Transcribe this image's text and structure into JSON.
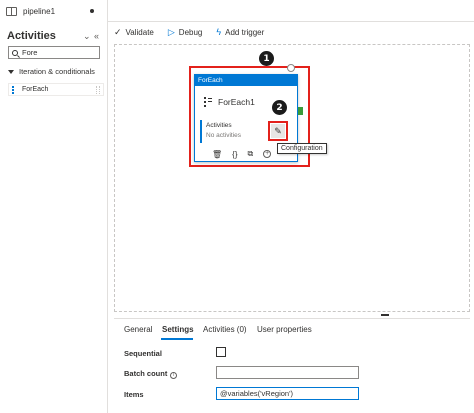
{
  "tab": {
    "label": "pipeline1"
  },
  "sidebar": {
    "title": "Activities",
    "collapse_glyph": "⌄",
    "minimize_glyph": "«",
    "search": {
      "value": "Fore"
    },
    "group": {
      "label": "Iteration & conditionals"
    },
    "items": [
      {
        "label": "ForEach"
      }
    ]
  },
  "toolbar": {
    "validate": {
      "label": "Validate",
      "icon": "checkmark-icon"
    },
    "debug": {
      "label": "Debug",
      "icon": "play-icon"
    },
    "add_trigger": {
      "label": "Add trigger",
      "icon": "trigger-icon"
    }
  },
  "canvas": {
    "callouts": [
      "1",
      "2"
    ],
    "activity": {
      "type_label": "ForEach",
      "name": "ForEach1",
      "inner_label": "Activities",
      "inner_value": "No activities",
      "tooltip": "Configuration"
    }
  },
  "properties": {
    "tabs": [
      {
        "label": "General",
        "active": false
      },
      {
        "label": "Settings",
        "active": true
      },
      {
        "label": "Activities (0)",
        "active": false
      },
      {
        "label": "User properties",
        "active": false
      }
    ],
    "fields": {
      "sequential": {
        "label": "Sequential",
        "checked": false
      },
      "batch_count": {
        "label": "Batch count",
        "value": ""
      },
      "items": {
        "label": "Items",
        "value": "@variables('vRegion')"
      }
    }
  },
  "colors": {
    "accent": "#0078d4",
    "highlight": "#e3211b",
    "success": "#3a9b3a"
  }
}
